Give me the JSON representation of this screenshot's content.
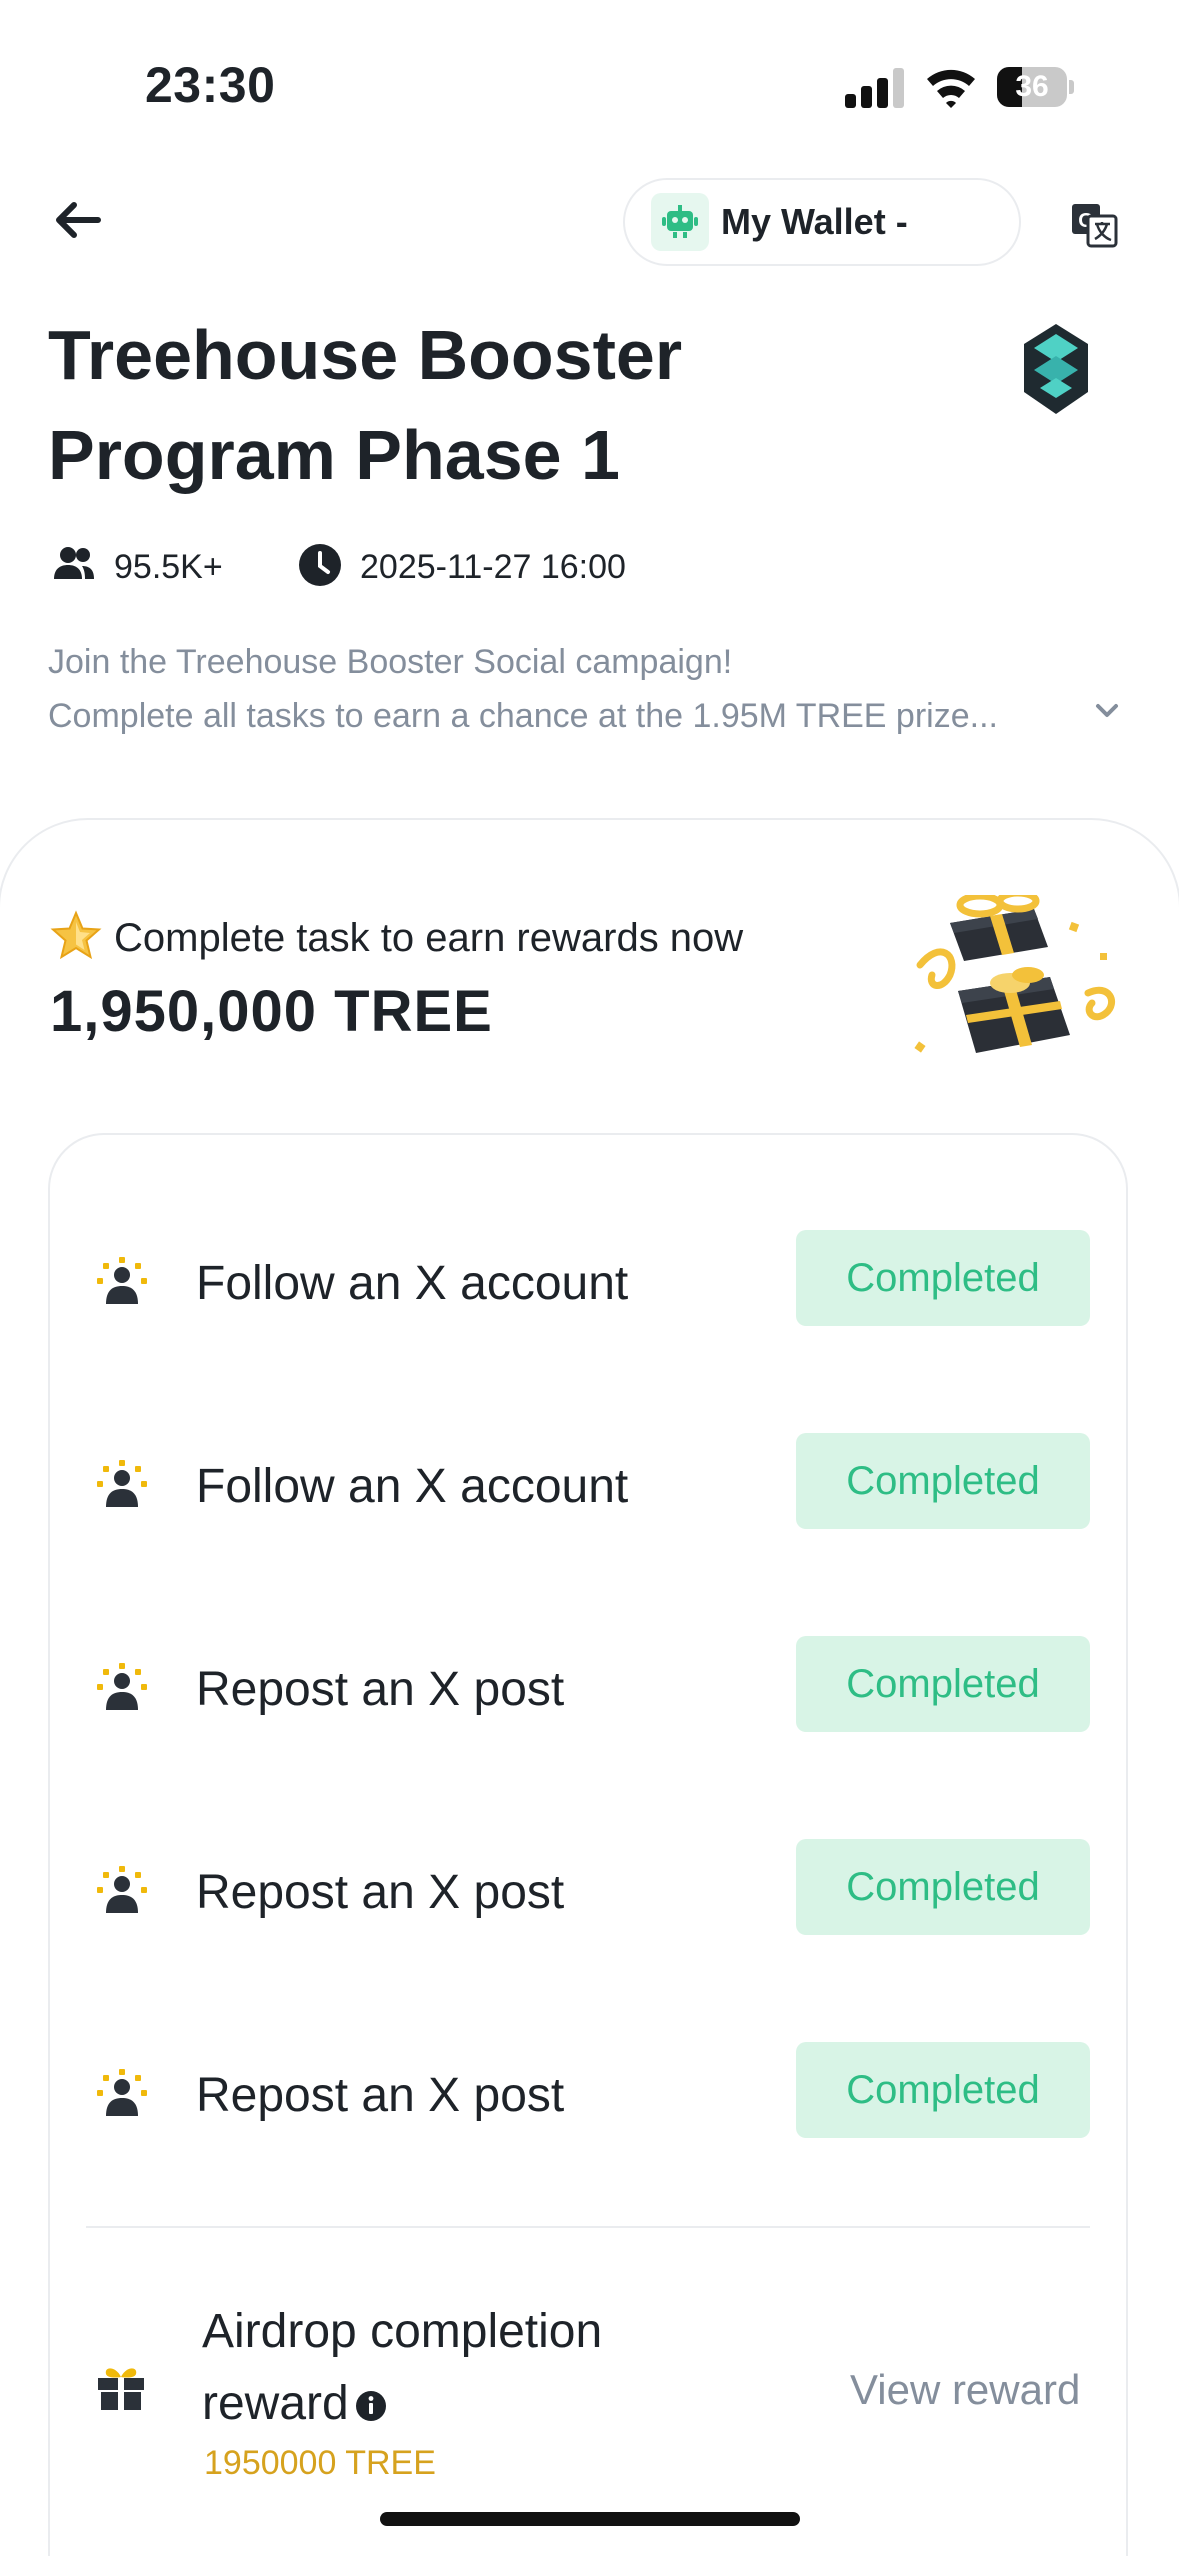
{
  "status_bar": {
    "time": "23:30",
    "battery": "36",
    "battery_percent": 36,
    "icons": [
      "cellular-signal-icon",
      "wifi-icon",
      "battery-icon"
    ]
  },
  "header": {
    "wallet_label": "My Wallet -",
    "icons": [
      "back-arrow-icon",
      "robot-icon",
      "translate-icon"
    ]
  },
  "campaign": {
    "title_line1": "Treehouse Booster",
    "title_line2": "Program Phase 1",
    "participants": "95.5K+",
    "end_time": "2025-11-27 16:00",
    "description_line1": "Join the Treehouse Booster Social campaign!",
    "description_line2": "Complete all tasks to earn a chance at the 1.95M TREE prize..."
  },
  "rewards": {
    "earn_label": "Complete task to earn rewards now",
    "total_amount": "1,950,000 TREE"
  },
  "tasks": [
    {
      "label": "Follow an X account",
      "status": "Completed"
    },
    {
      "label": "Follow an X account",
      "status": "Completed"
    },
    {
      "label": "Repost an X post",
      "status": "Completed"
    },
    {
      "label": "Repost an X post",
      "status": "Completed"
    },
    {
      "label": "Repost an X post",
      "status": "Completed"
    }
  ],
  "airdrop": {
    "title_line1": "Airdrop completion",
    "title_line2": "reward",
    "amount": "1950000 TREE",
    "action": "View reward"
  },
  "colors": {
    "accent_green": "#2ebd85",
    "completed_bg": "#d8f4e6",
    "reward_gold": "#d6a21e",
    "muted_text": "#848e9c",
    "primary_text": "#1e2329"
  }
}
